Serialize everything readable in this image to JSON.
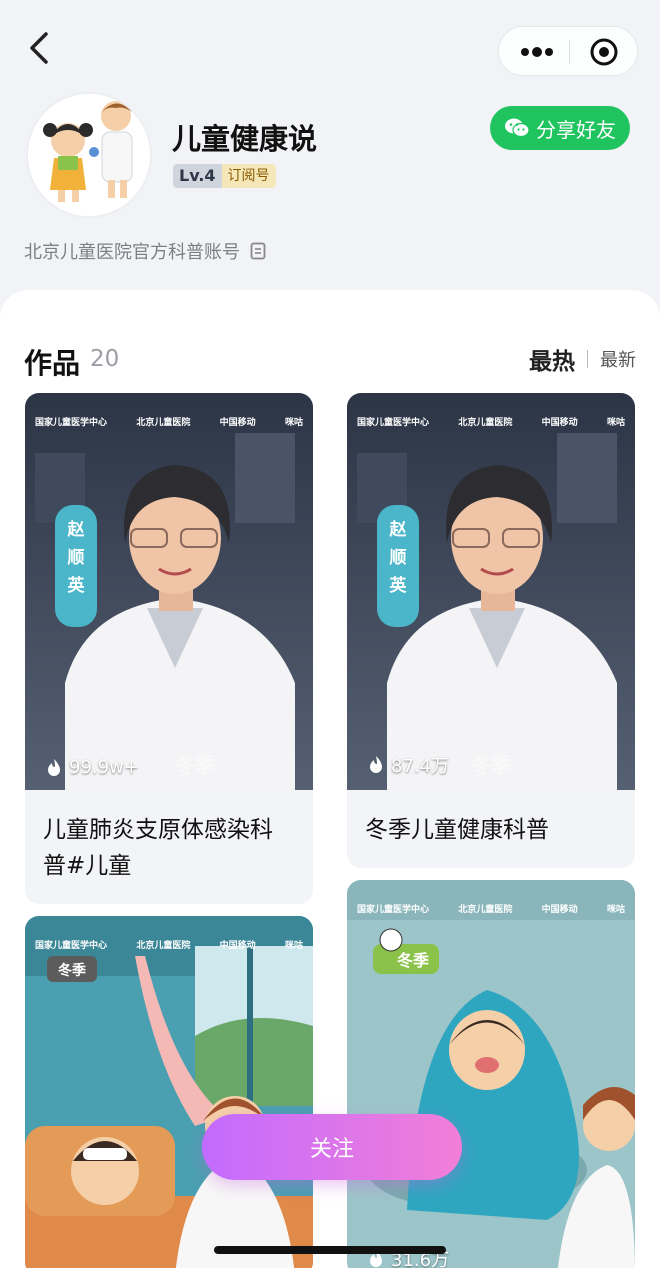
{
  "header": {
    "back_icon": "chevron-left-icon",
    "more_icon": "more-dots-icon",
    "close_icon": "target-circle-icon"
  },
  "profile": {
    "name": "儿童健康说",
    "level": "Lv.4",
    "account_type": "订阅号",
    "description": "北京儿童医院官方科普账号",
    "share_label": "分享好友"
  },
  "works": {
    "title": "作品",
    "count": "20",
    "sort_hot": "最热",
    "sort_new": "最新",
    "items": [
      {
        "views": "99.9w+",
        "caption": "儿童肺炎支原体感染科普#儿童",
        "overlay": "冬季",
        "name_tag": "赵顺英"
      },
      {
        "views": "87.4万",
        "caption": "冬季儿童健康科普",
        "overlay": "冬季",
        "name_tag": "赵顺英"
      },
      {
        "views": "",
        "caption": "",
        "badge": "冬季"
      },
      {
        "views": "31.6万",
        "caption": "",
        "badge": "冬季"
      }
    ],
    "logos": {
      "center": "国家儿童医学中心",
      "hospital": "北京儿童医院",
      "mobile": "中国移动",
      "migu": "咪咕"
    }
  },
  "actions": {
    "follow_label": "关注"
  },
  "colors": {
    "share_green": "#1fc45f",
    "follow_gradient_start": "#c36bff",
    "follow_gradient_end": "#f27ed7"
  }
}
